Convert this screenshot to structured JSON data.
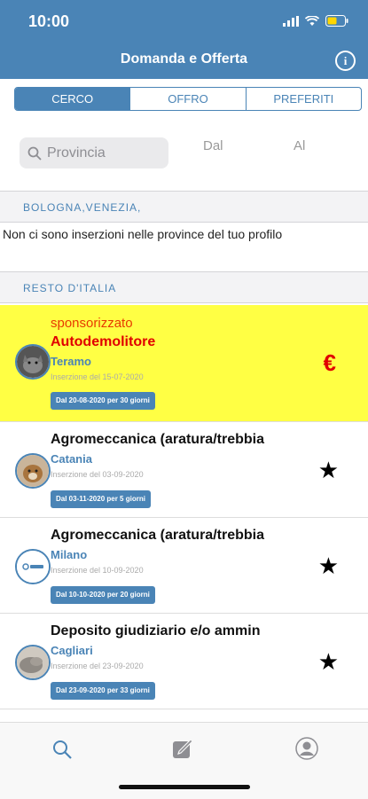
{
  "status": {
    "time": "10:00"
  },
  "header": {
    "title": "Domanda e Offerta",
    "info_label": "i"
  },
  "tabs": [
    {
      "label": "CERCO",
      "active": true
    },
    {
      "label": "OFFRO",
      "active": false
    },
    {
      "label": "PREFERITI",
      "active": false
    }
  ],
  "filters": {
    "search_placeholder": "Provincia",
    "from_label": "Dal",
    "to_label": "Al"
  },
  "profile_section": {
    "title": "BOLOGNA,VENEZIA,",
    "empty_message": "Non ci sono inserzioni nelle province del tuo profilo"
  },
  "rest_section": {
    "title": "RESTO D'ITALIA"
  },
  "listings": [
    {
      "sponsored_label": "sponsorizzato",
      "title": "Autodemolitore",
      "city": "Teramo",
      "posted": "Inserzione del 15-07-2020",
      "badge": "Dal 20-08-2020 per 30 giorni",
      "mark": "€",
      "mark_icon": "euro-icon",
      "avatar_icon": "wolf-avatar-icon"
    },
    {
      "title": "Agromeccanica (aratura/trebbia",
      "city": "Catania",
      "posted": "Inserzione del 03-09-2020",
      "badge": "Dal 03-11-2020 per 5 giorni",
      "mark": "★",
      "mark_icon": "star-icon",
      "avatar_icon": "dog-avatar-icon"
    },
    {
      "title": "Agromeccanica (aratura/trebbia",
      "city": "Milano",
      "posted": "Inserzione del 10-09-2020",
      "badge": "Dal 10-10-2020 per 20 giorni",
      "mark": "★",
      "mark_icon": "star-icon",
      "avatar_icon": "logo-avatar-icon"
    },
    {
      "title": "Deposito giudiziario e/o ammin",
      "city": "Cagliari",
      "posted": "Inserzione del 23-09-2020",
      "badge": "Dal 23-09-2020 per 33 giorni",
      "mark": "★",
      "mark_icon": "star-icon",
      "avatar_icon": "rock-avatar-icon"
    }
  ],
  "bottom_nav": [
    {
      "icon": "search-icon"
    },
    {
      "icon": "compose-icon"
    },
    {
      "icon": "profile-icon"
    }
  ],
  "colors": {
    "accent": "#4a84b6",
    "sponsored_bg": "#ffff44",
    "sponsored_text": "#e00000"
  }
}
